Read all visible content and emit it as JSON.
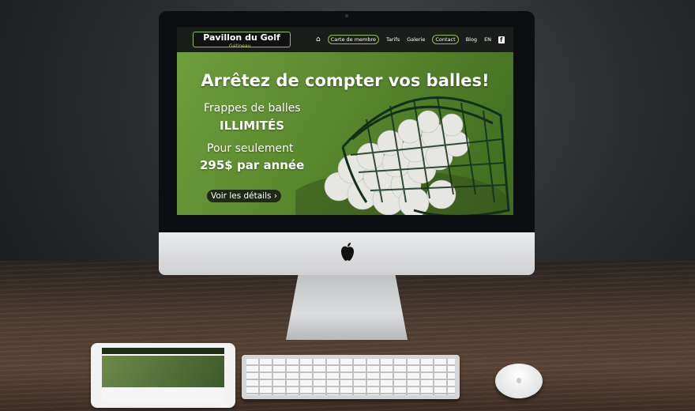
{
  "site": {
    "logo_text": "Pavillon du Golf",
    "logo_subtext": "Gatineau",
    "menu": [
      "Carte de membre",
      "Tarifs",
      "Galerie",
      "Contact",
      "Blog",
      "EN"
    ],
    "home_icon": "home-icon",
    "social_icon": "facebook-icon"
  },
  "hero": {
    "title": "Arrêtez de compter vos balles!",
    "line1": "Frappes de balles",
    "line2": "ILLIMITÉS",
    "line3": "Pour seulement",
    "line4": "295$ par année",
    "button": "Voir les détails ›"
  },
  "colors": {
    "accent": "#8ac43f",
    "nav_bg": "#1b1d1a",
    "hero_green": "#5c8c2f"
  }
}
